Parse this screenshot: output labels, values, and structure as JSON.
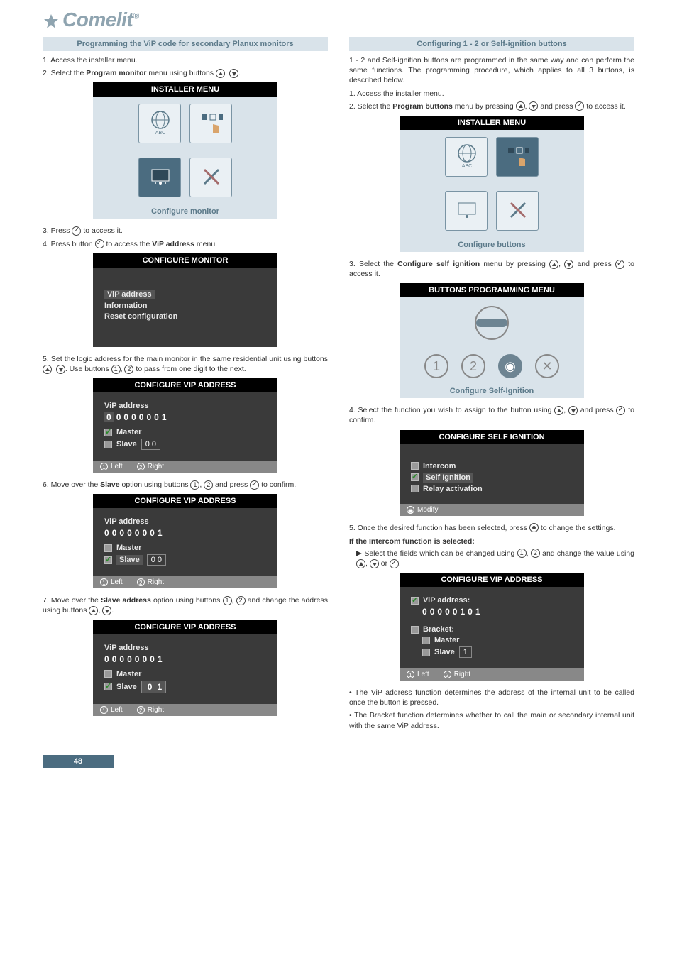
{
  "brand": "Comelit",
  "page_number": "48",
  "left": {
    "header": "Programming the ViP code for secondary Planux monitors",
    "step1": "1. Access the installer menu.",
    "step2_a": "2. Select the ",
    "step2_b": "Program monitor",
    "step2_c": " menu using buttons ",
    "step2_d": ".",
    "menu1_title": "INSTALLER MENU",
    "menu1_caption": "Configure monitor",
    "step3": "3. Press ",
    "step3b": " to access it.",
    "step4": "4. Press button ",
    "step4b": " to access the ",
    "step4c": "ViP address",
    "step4d": " menu.",
    "menu2_title": "CONFIGURE MONITOR",
    "menu2_item1": "ViP address",
    "menu2_item2": "Information",
    "menu2_item3": "Reset configuration",
    "step5a": "5. Set the logic address for the main monitor in the same residential unit using buttons ",
    "step5b": ". Use buttons ",
    "step5c": " to pass from one digit to the next.",
    "cfg1_title": "CONFIGURE VIP ADDRESS",
    "cfg1_vip": "ViP address",
    "cfg1_master": "Master",
    "cfg1_slave": "Slave",
    "cfg1_slave_digits": "0 0",
    "foot_left": "Left",
    "foot_right": "Right",
    "step6a": "6. Move over the ",
    "step6b": "Slave",
    "step6c": " option using buttons ",
    "step6d": " and press ",
    "step6e": " to confirm.",
    "cfg2_title": "CONFIGURE VIP ADDRESS",
    "step7a": "7. Move over the ",
    "step7b": "Slave address",
    "step7c": " option using buttons ",
    "step7d": " and change the address using buttons ",
    "step7e": ".",
    "cfg3_title": "CONFIGURE VIP ADDRESS",
    "cfg3_slave_digits": "0  1"
  },
  "right": {
    "header": "Configuring 1 - 2 or Self-ignition buttons",
    "intro": "1 - 2 and Self-ignition buttons are programmed in the same way and can perform the same functions. The programming procedure, which applies to all 3 buttons, is described below.",
    "step1": "1. Access the installer menu.",
    "step2_a": "2. Select the ",
    "step2_b": "Program buttons",
    "step2_c": " menu by pressing ",
    "step2_d": " and press ",
    "step2_e": " to access it.",
    "menu1_title": "INSTALLER MENU",
    "menu1_caption": "Configure buttons",
    "step3a": "3. Select the ",
    "step3b": "Configure self ignition",
    "step3c": " menu by pressing ",
    "step3d": " and press ",
    "step3e": " to access it.",
    "menu2_title": "BUTTONS PROGRAMMING MENU",
    "menu2_caption": "Configure Self-Ignition",
    "step4a": "4. Select the function you wish to assign to the button using ",
    "step4b": " and press ",
    "step4c": " to confirm.",
    "cfg1_title": "CONFIGURE SELF IGNITION",
    "cfg1_item1": "Intercom",
    "cfg1_item2": "Self Ignition",
    "cfg1_item3": "Relay activation",
    "cfg1_footer": "Modify",
    "step5a": "5. Once the desired function has been selected, press ",
    "step5b": " to change the settings.",
    "subhead": "If the Intercom function is selected:",
    "indent_a": "Select the fields which can be changed using ",
    "indent_b": " and change the value using ",
    "indent_c": " or ",
    "indent_d": ".",
    "cfg2_title": "CONFIGURE VIP ADDRESS",
    "cfg2_vip": "ViP address:",
    "cfg2_digits": "0 0 0 0 0 1 0 1",
    "cfg2_bracket": "Bracket:",
    "cfg2_master": "Master",
    "cfg2_slave": "Slave",
    "cfg2_slave_d": "1",
    "bullet1a": "• The ",
    "bullet1b": "ViP address",
    "bullet1c": " function determines the address of the internal unit to be called once the button is pressed.",
    "bullet2a": "• The ",
    "bullet2b": "Bracket",
    "bullet2c": " function determines whether to call the main or secondary internal unit with the same ViP address."
  }
}
